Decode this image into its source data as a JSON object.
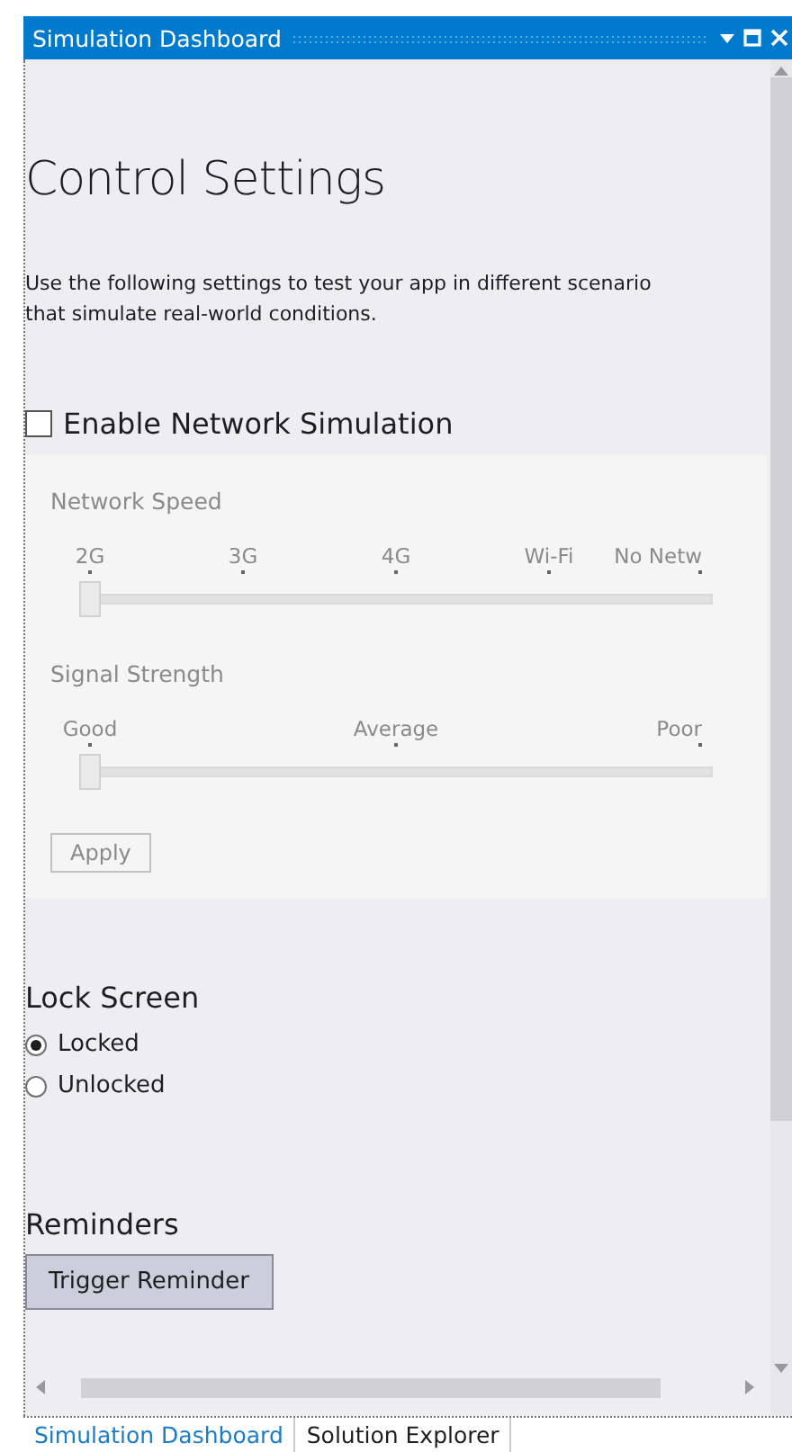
{
  "window": {
    "title": "Simulation Dashboard"
  },
  "heading": "Control Settings",
  "description": [
    "Use the following settings to test your app in different scenario",
    "that simulate real-world conditions."
  ],
  "network_simulation": {
    "label": "Enable Network Simulation",
    "checked": false,
    "sliders": [
      {
        "label": "Network Speed",
        "ticks": [
          "2G",
          "3G",
          "4G",
          "Wi-Fi",
          "No Netw"
        ],
        "level": 0
      },
      {
        "label": "Signal Strength",
        "ticks": [
          "Good",
          "Average",
          "Poor"
        ],
        "level": 0
      }
    ],
    "apply_button": "Apply"
  },
  "lock_screen": {
    "title": "Lock Screen",
    "options": [
      {
        "label": "Locked",
        "selected": true
      },
      {
        "label": "Unlocked",
        "selected": false
      }
    ]
  },
  "reminders": {
    "title": "Reminders",
    "button": "Trigger Reminder"
  },
  "bottom_tabs": [
    {
      "label": "Simulation Dashboard",
      "selected": true
    },
    {
      "label": "Solution Explorer",
      "selected": false
    }
  ]
}
